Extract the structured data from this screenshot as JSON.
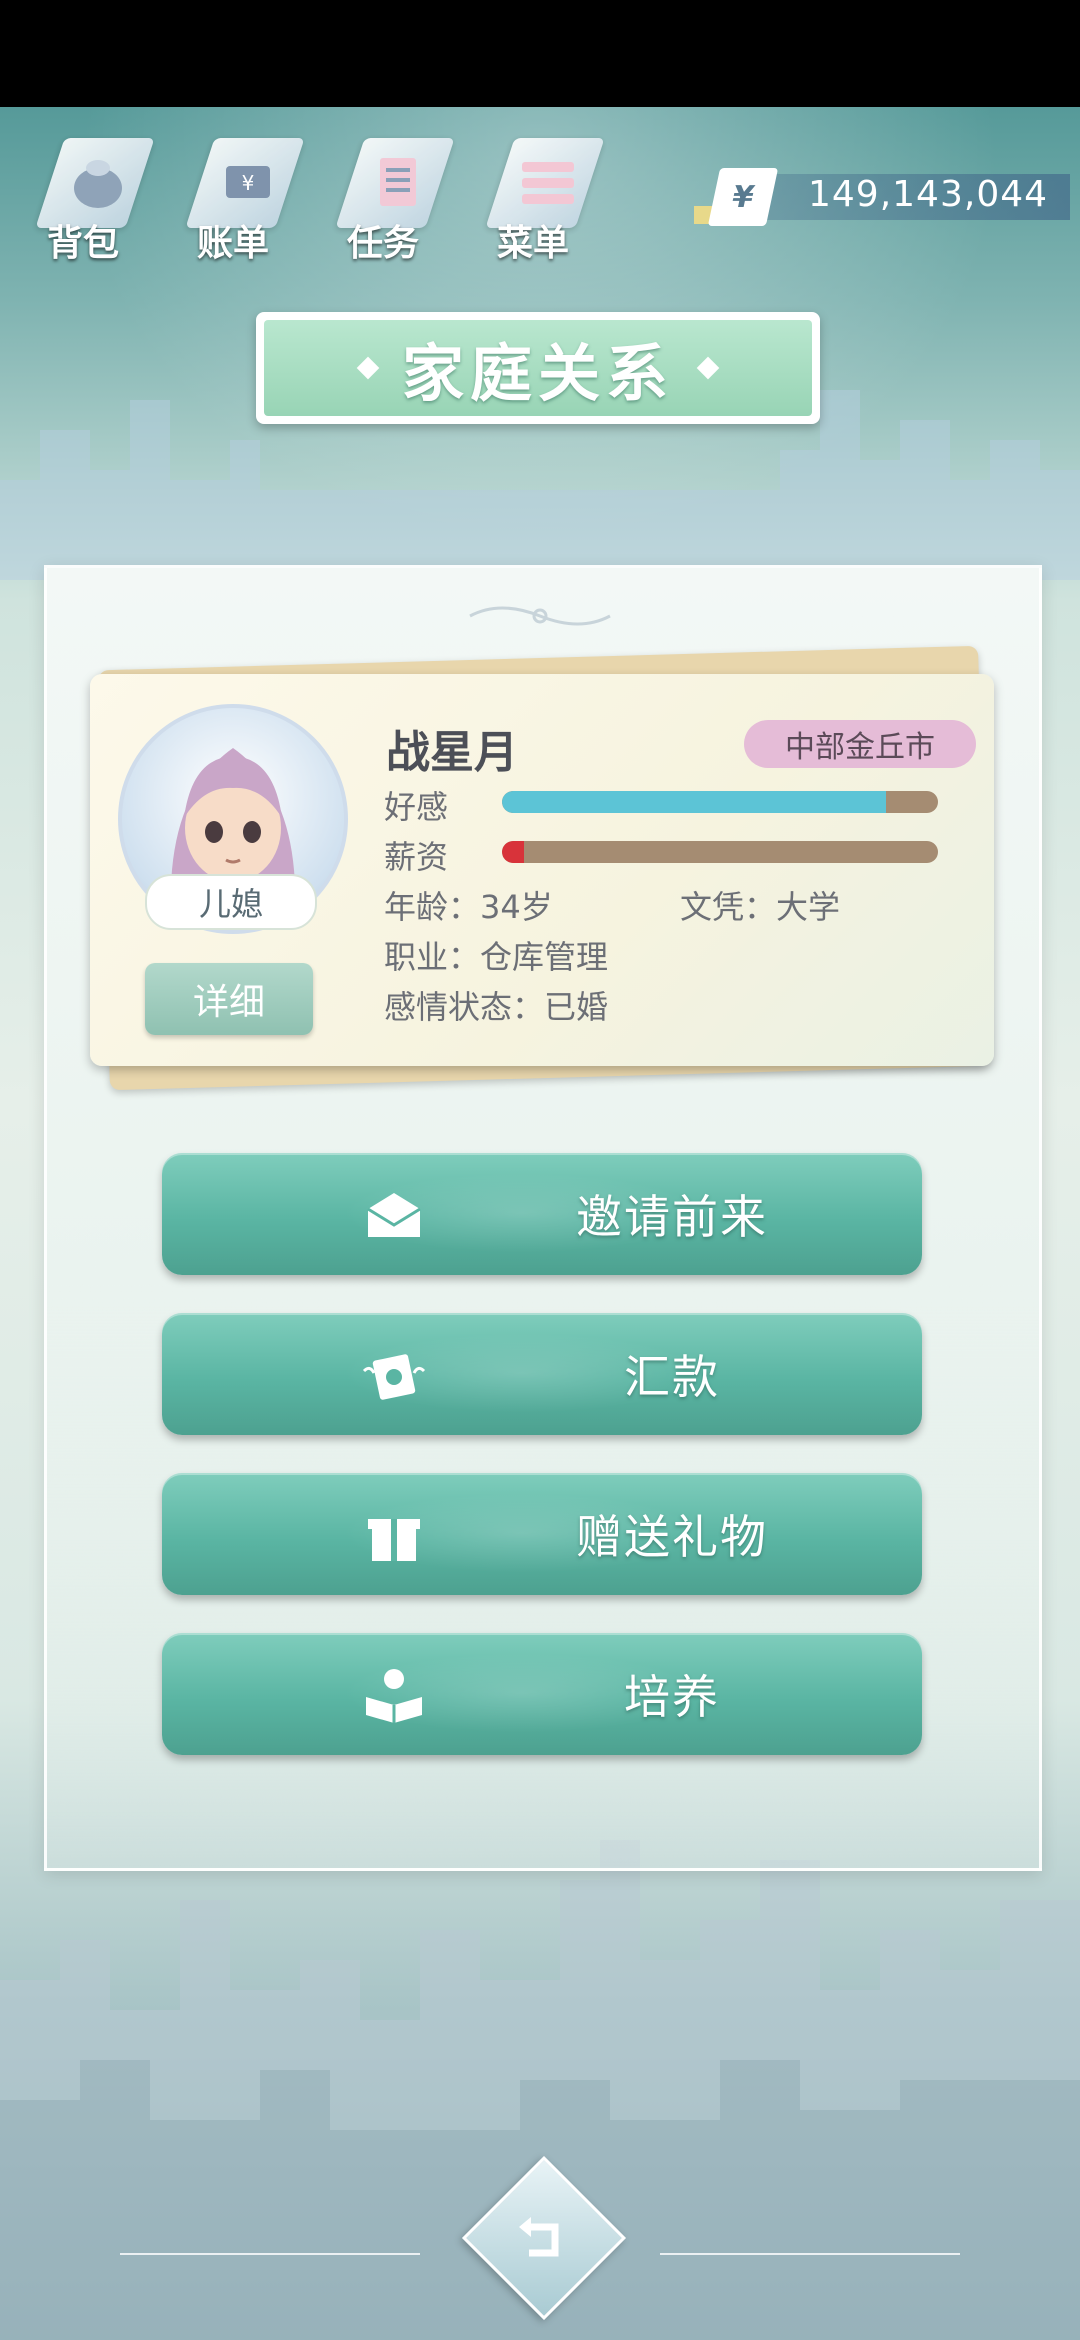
{
  "toolbar": {
    "items": [
      {
        "label": "背包",
        "icon": "bag-icon"
      },
      {
        "label": "账单",
        "icon": "bill-icon"
      },
      {
        "label": "任务",
        "icon": "task-list-icon"
      },
      {
        "label": "菜单",
        "icon": "menu-icon"
      }
    ]
  },
  "money": {
    "currency_symbol": "¥",
    "amount": "149,143,044"
  },
  "title": "家庭关系",
  "profile": {
    "name": "战星月",
    "location": "中部金丘市",
    "relation": "儿媳",
    "detail_label": "详细",
    "stats": {
      "favor_label": "好感",
      "favor_level": 0.88,
      "salary_label": "薪资",
      "salary_level": 0.05
    },
    "age": "年龄：34岁",
    "education": "文凭：大学",
    "occupation": "职业：仓库管理",
    "relationship_status": "感情状态：已婚"
  },
  "actions": [
    {
      "label": "邀请前来",
      "icon": "invite-letter-icon"
    },
    {
      "label": "汇款",
      "icon": "money-transfer-icon"
    },
    {
      "label": "赠送礼物",
      "icon": "gift-icon"
    },
    {
      "label": "培养",
      "icon": "reading-person-icon"
    }
  ],
  "colors": {
    "action_button": "#5ab5a3",
    "title_banner": "#98d4b5",
    "favor_bar": "#5cc4d6",
    "salary_bar": "#d8333a",
    "location_badge": "#e5bcd7"
  }
}
